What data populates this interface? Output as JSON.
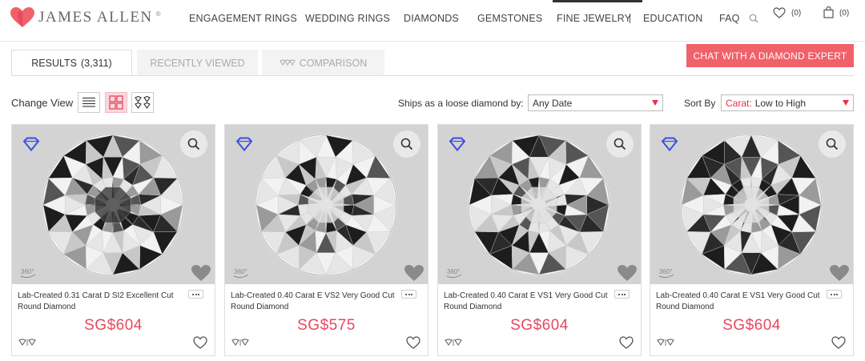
{
  "brand": {
    "name": "JAMES ALLEN",
    "mark": "®",
    "accent": "#f0616a",
    "price_color": "#e8485e"
  },
  "nav": [
    {
      "id": "engagement",
      "label": "ENGAGEMENT RINGS"
    },
    {
      "id": "wedding",
      "label": "WEDDING RINGS"
    },
    {
      "id": "diamonds",
      "label": "DIAMONDS"
    },
    {
      "id": "gemstones",
      "label": "GEMSTONES"
    },
    {
      "id": "fine",
      "label": "FINE JEWELRY"
    },
    {
      "id": "education",
      "label": "EDUCATION"
    },
    {
      "id": "faq",
      "label": "FAQ"
    }
  ],
  "header": {
    "wishlist_count": "(0)",
    "cart_count": "(0)",
    "search_icon": "search-icon",
    "wishlist_icon": "heart-icon",
    "cart_icon": "shopping-bag-icon"
  },
  "tabs": {
    "results_label": "RESULTS",
    "results_count": "(3,311)",
    "recent_label": "RECENTLY VIEWED",
    "compare_label": "COMPARISON"
  },
  "chat_button": "CHAT WITH A DIAMOND EXPERT",
  "filters": {
    "change_view_label": "Change View",
    "views": [
      "list-view-icon",
      "grid-view-icon",
      "diamond-view-icon"
    ],
    "active_view": "grid-view-icon",
    "ship_label": "Ships as a loose diamond by:",
    "ship_value": "Any Date",
    "sort_label": "Sort By",
    "sort_key": "Carat:",
    "sort_value": "Low to High"
  },
  "products": [
    {
      "title": "Lab-Created 0.31 Carat D SI2 Excellent Cut Round Diamond",
      "price": "SG$604"
    },
    {
      "title": "Lab-Created 0.40 Carat E VS2 Very Good Cut Round Diamond",
      "price": "SG$575"
    },
    {
      "title": "Lab-Created 0.40 Carat E VS1 Very Good Cut Round Diamond",
      "price": "SG$604"
    },
    {
      "title": "Lab-Created 0.40 Carat E VS1 Very Good Cut Round Diamond",
      "price": "SG$604"
    }
  ],
  "card_labels": {
    "rotation": "360°"
  }
}
